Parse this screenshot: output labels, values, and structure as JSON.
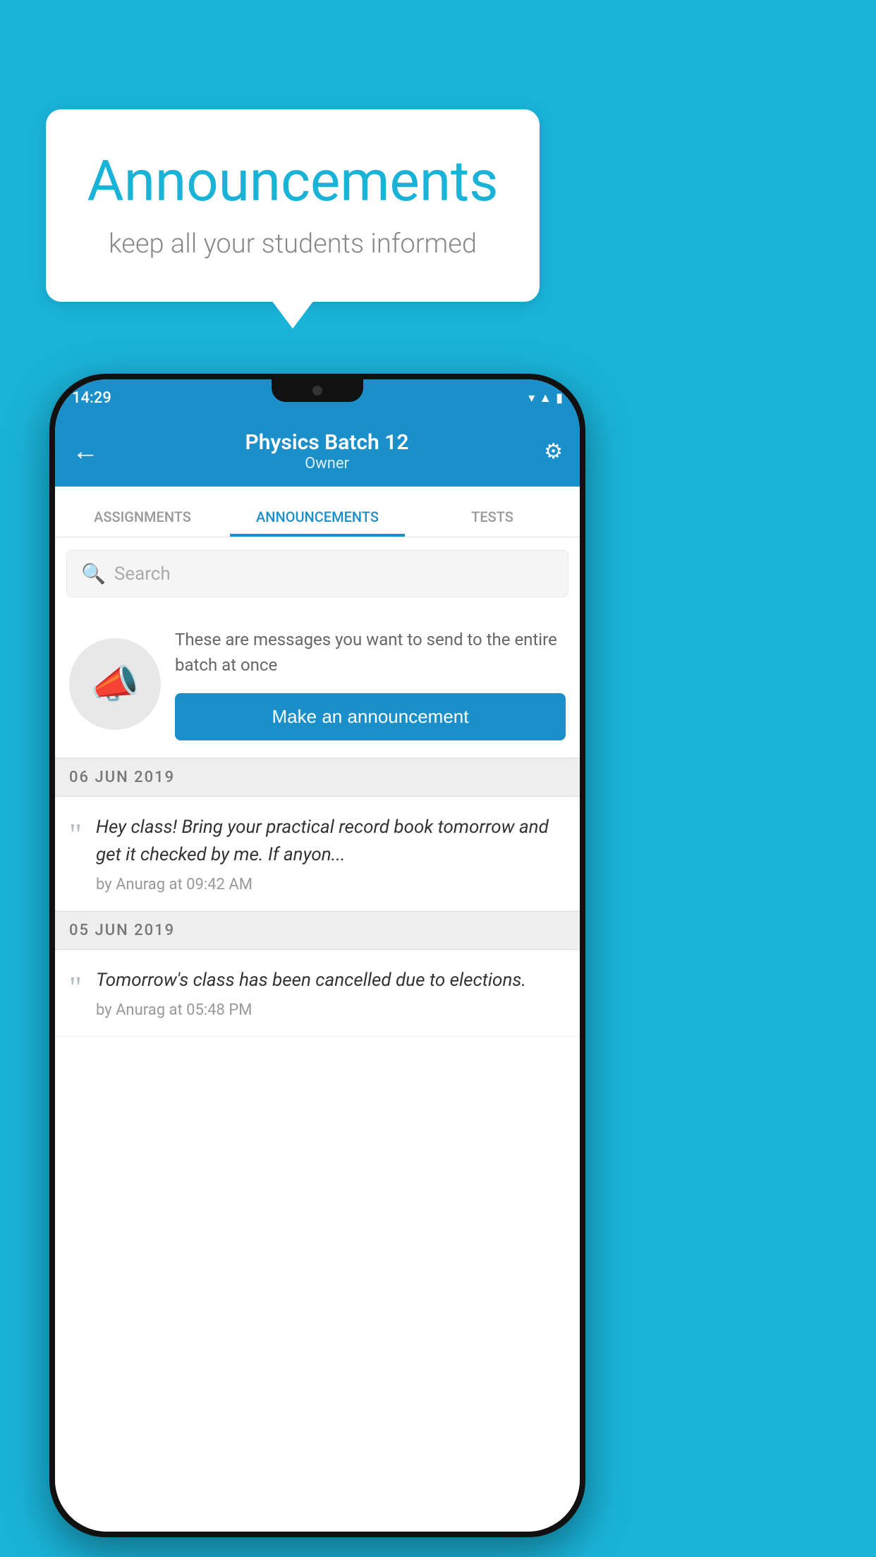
{
  "background_color": "#1ab3d8",
  "speech_bubble": {
    "title": "Announcements",
    "subtitle": "keep all your students informed"
  },
  "status_bar": {
    "time": "14:29",
    "icons": [
      "wifi",
      "signal",
      "battery"
    ]
  },
  "app_bar": {
    "back_label": "←",
    "title": "Physics Batch 12",
    "subtitle": "Owner",
    "settings_label": "⚙"
  },
  "tabs": [
    {
      "label": "ASSIGNMENTS",
      "active": false
    },
    {
      "label": "ANNOUNCEMENTS",
      "active": true
    },
    {
      "label": "TESTS",
      "active": false
    }
  ],
  "search": {
    "placeholder": "Search"
  },
  "promo": {
    "description": "These are messages you want to send to the entire batch at once",
    "button_label": "Make an announcement"
  },
  "announcements": [
    {
      "date": "06  JUN  2019",
      "items": [
        {
          "text": "Hey class! Bring your practical record book tomorrow and get it checked by me. If anyon...",
          "meta": "by Anurag at 09:42 AM"
        }
      ]
    },
    {
      "date": "05  JUN  2019",
      "items": [
        {
          "text": "Tomorrow's class has been cancelled due to elections.",
          "meta": "by Anurag at 05:48 PM"
        }
      ]
    }
  ]
}
